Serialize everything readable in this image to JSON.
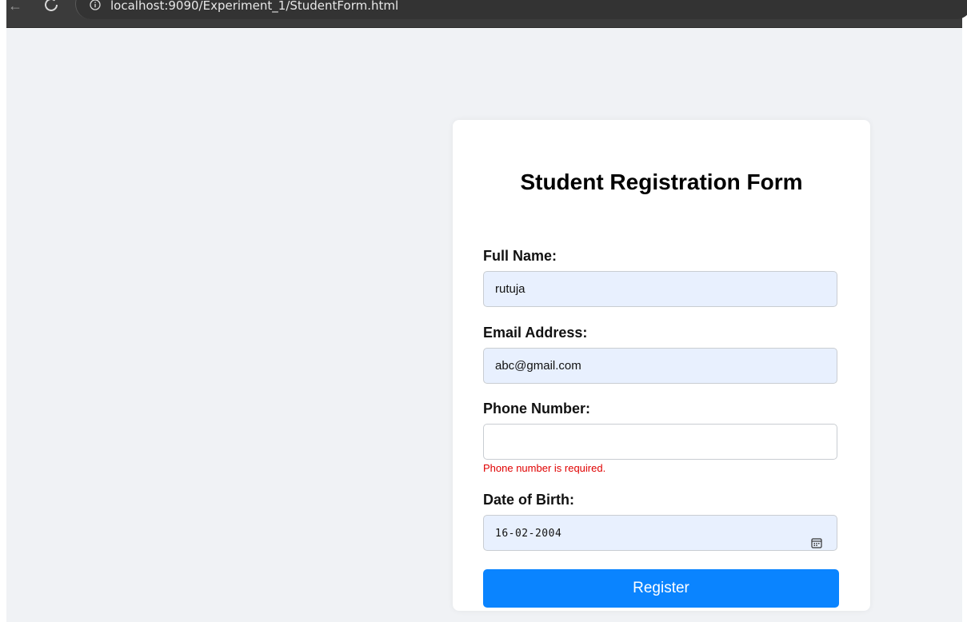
{
  "browser": {
    "url": "localhost:9090/Experiment_1/StudentForm.html"
  },
  "form": {
    "title": "Student Registration Form",
    "full_name": {
      "label": "Full Name:",
      "value": "rutuja"
    },
    "email": {
      "label": "Email Address:",
      "value": "abc@gmail.com"
    },
    "phone": {
      "label": "Phone Number:",
      "value": "",
      "error": "Phone number is required."
    },
    "dob": {
      "label": "Date of Birth:",
      "value": "16-02-2004"
    },
    "submit_label": "Register"
  },
  "icons": {
    "back": "arrow-left-icon",
    "reload": "reload-icon",
    "info": "info-icon",
    "calendar": "calendar-icon"
  },
  "colors": {
    "page_bg": "#f0f2f5",
    "card_bg": "#ffffff",
    "autofill_bg": "#e8f0fe",
    "error": "#e00000",
    "button": "#0a84ff"
  }
}
